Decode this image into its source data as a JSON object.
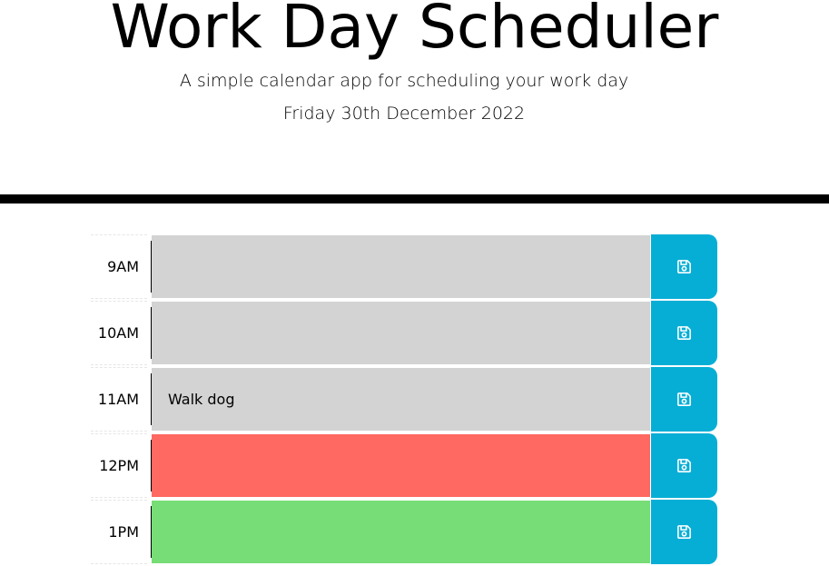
{
  "header": {
    "title": "Work Day Scheduler",
    "subtitle": "A simple calendar app for scheduling your work day",
    "current_date": "Friday 30th December 2022"
  },
  "colors": {
    "past": "#d3d3d3",
    "present": "#ff6961",
    "future": "#77dd77",
    "save_button": "#06aed5"
  },
  "time_blocks": [
    {
      "hour": "9AM",
      "status": "past",
      "text": "",
      "save_icon": "floppy-disk-icon"
    },
    {
      "hour": "10AM",
      "status": "past",
      "text": "",
      "save_icon": "floppy-disk-icon"
    },
    {
      "hour": "11AM",
      "status": "past",
      "text": "Walk dog",
      "save_icon": "floppy-disk-icon"
    },
    {
      "hour": "12PM",
      "status": "present",
      "text": "",
      "save_icon": "floppy-disk-icon"
    },
    {
      "hour": "1PM",
      "status": "future",
      "text": "",
      "save_icon": "floppy-disk-icon"
    }
  ]
}
